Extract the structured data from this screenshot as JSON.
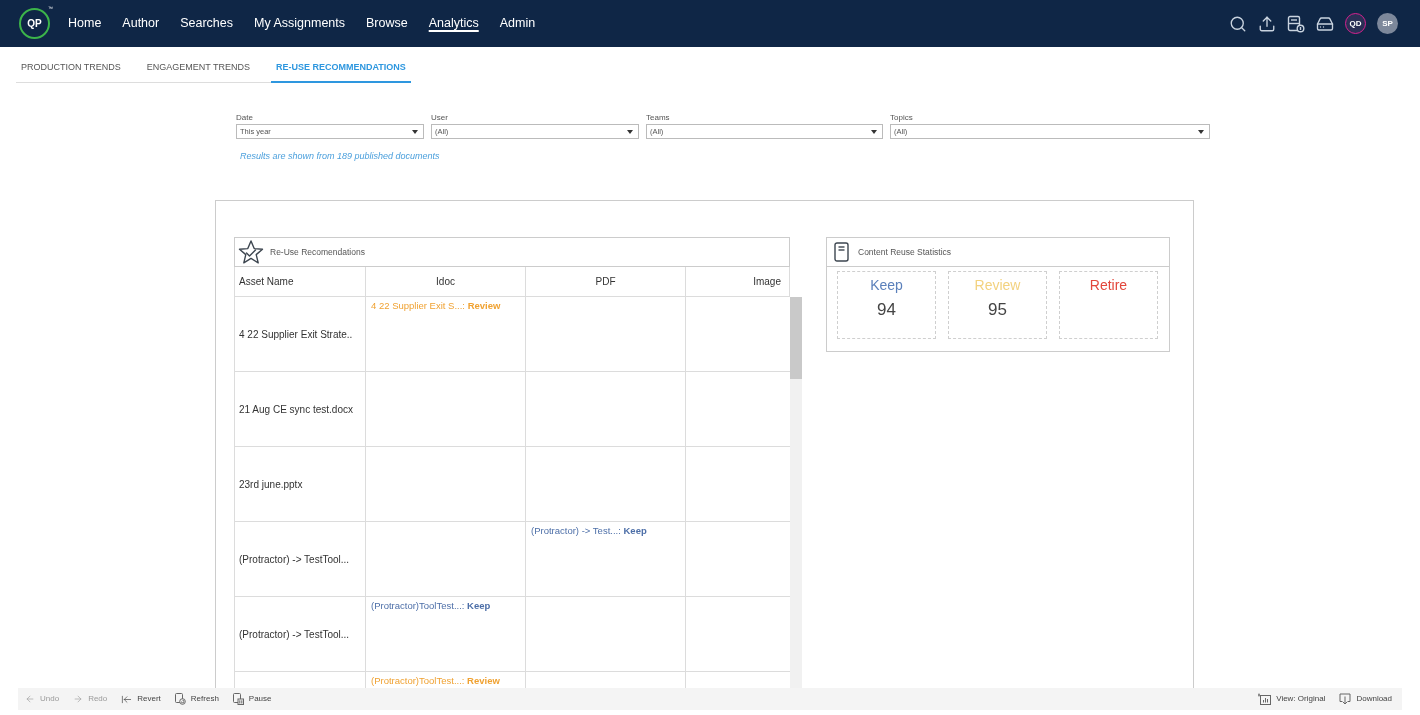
{
  "logo": {
    "text": "QP",
    "mark": "™"
  },
  "nav": [
    {
      "label": "Home",
      "selected": false
    },
    {
      "label": "Author",
      "selected": false
    },
    {
      "label": "Searches",
      "selected": false
    },
    {
      "label": "My Assignments",
      "selected": false
    },
    {
      "label": "Browse",
      "selected": false
    },
    {
      "label": "Analytics",
      "selected": true
    },
    {
      "label": "Admin",
      "selected": false
    }
  ],
  "avatars": [
    {
      "initials": "QD",
      "kind": "ring"
    },
    {
      "initials": "SP",
      "kind": "plain"
    }
  ],
  "tabs": [
    {
      "label": "PRODUCTION TRENDS",
      "selected": false
    },
    {
      "label": "ENGAGEMENT TRENDS",
      "selected": false
    },
    {
      "label": "RE-USE RECOMMENDATIONS",
      "selected": true
    }
  ],
  "filters": [
    {
      "label": "Date",
      "value": "This year"
    },
    {
      "label": "User",
      "value": "(All)"
    },
    {
      "label": "Teams",
      "value": "(All)"
    },
    {
      "label": "Topics",
      "value": "(All)"
    }
  ],
  "results_note": "Results are shown from 189 published documents",
  "recommendations": {
    "title": "Re-Use Recomendations",
    "columns": [
      "Asset Name",
      "Idoc",
      "PDF",
      "Image"
    ],
    "rows": [
      {
        "asset_name": "4 22 Supplier Exit Strate..",
        "idoc": {
          "text": "4 22 Supplier Exit S...: **Review**",
          "kind": "review"
        }
      },
      {
        "asset_name": "21 Aug CE sync test.docx"
      },
      {
        "asset_name": "23rd june.pptx"
      },
      {
        "asset_name": "(Protractor) -> TestTool...",
        "pdf": {
          "text": "(Protractor) -> Test...: **Keep**",
          "kind": "keep"
        }
      },
      {
        "asset_name": "(Protractor) -> TestTool...",
        "idoc": {
          "text": "(Protractor)ToolTest...: **Keep**",
          "kind": "keep"
        }
      },
      {
        "idoc": {
          "text": "(Protractor)ToolTest...: **Review**",
          "kind": "review"
        }
      }
    ]
  },
  "statistics": {
    "title": "Content Reuse Statistics",
    "items": [
      {
        "label": "Keep",
        "value": "94",
        "kind": "keep"
      },
      {
        "label": "Review",
        "value": "95",
        "kind": "review"
      },
      {
        "label": "Retire",
        "kind": "retire"
      }
    ]
  },
  "toolbar": {
    "left": [
      {
        "label": "Undo",
        "disabled": true
      },
      {
        "label": "Redo",
        "disabled": true
      },
      {
        "label": "Revert",
        "disabled": false
      },
      {
        "label": "Refresh",
        "disabled": false
      },
      {
        "label": "Pause",
        "disabled": false
      }
    ],
    "right": [
      {
        "label": "View: Original"
      },
      {
        "label": "Download"
      }
    ]
  }
}
